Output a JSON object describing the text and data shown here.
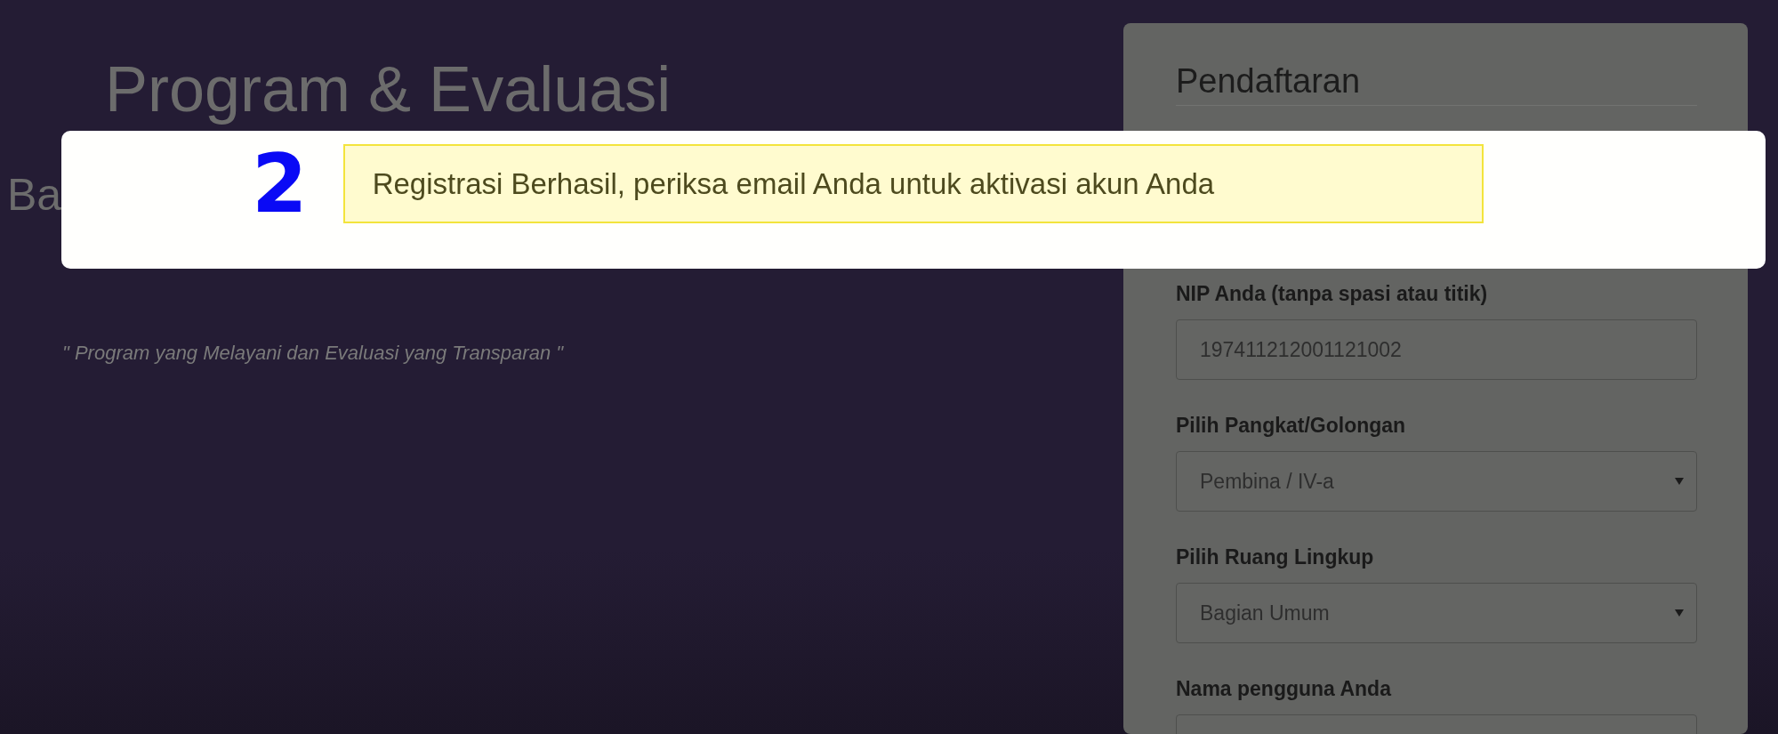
{
  "intro": {
    "title": "Program & Evaluasi",
    "subtitle_lines": [
      "Ba"
    ],
    "motto": "\" Program yang Melayani dan Evaluasi yang Transparan \""
  },
  "registration_form": {
    "title": "Pendaftaran",
    "fields": [
      {
        "kind": "input",
        "label": "NIP Anda (tanpa spasi atau titik)",
        "value": "197411212001121002"
      },
      {
        "kind": "select",
        "label": "Pilih Pangkat/Golongan",
        "value": "Pembina / IV-a"
      },
      {
        "kind": "select",
        "label": "Pilih Ruang Lingkup",
        "value": "Bagian Umum"
      },
      {
        "kind": "input",
        "label": "Nama pengguna Anda"
      }
    ]
  },
  "dialog": {
    "step_number": "2",
    "alert": "Registrasi Berhasil, periksa email Anda untuk aktivasi akun Anda"
  }
}
